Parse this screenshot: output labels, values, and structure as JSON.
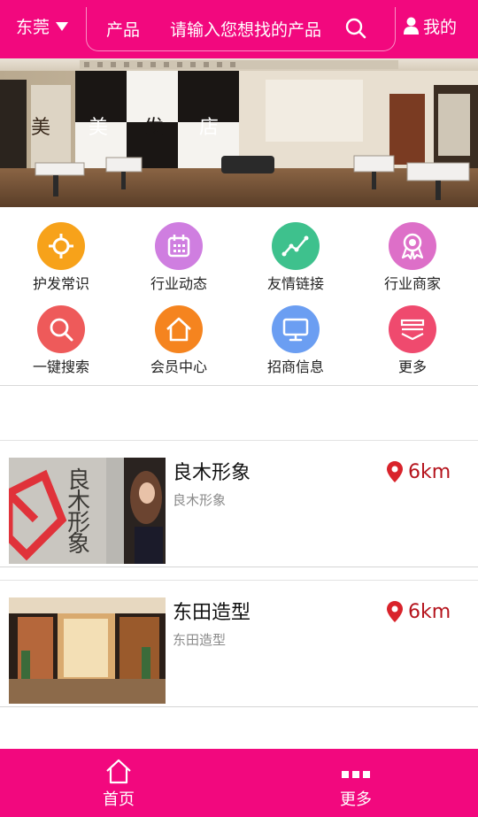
{
  "header": {
    "city": "东莞",
    "search_category": "产品",
    "search_placeholder": "请输入您想找的产品",
    "search_icon": "search-icon",
    "account_label": "我的",
    "account_icon": "user-icon",
    "bg_color": "#f2087e"
  },
  "banner": {
    "sign_chars": [
      "美",
      "美",
      "发",
      "店"
    ]
  },
  "quick_menu": [
    {
      "label": "护发常识",
      "icon": "crosshair-icon",
      "color": "#f7a21a"
    },
    {
      "label": "行业动态",
      "icon": "calendar-icon",
      "color": "#cf7ee0"
    },
    {
      "label": "友情链接",
      "icon": "trend-chart-icon",
      "color": "#3ec18d"
    },
    {
      "label": "行业商家",
      "icon": "award-ribbon-icon",
      "color": "#dd6fc8"
    },
    {
      "label": "一键搜索",
      "icon": "search-icon",
      "color": "#ee5a5a"
    },
    {
      "label": "会员中心",
      "icon": "home-icon",
      "color": "#f5841f"
    },
    {
      "label": "招商信息",
      "icon": "monitor-icon",
      "color": "#6b9ef2"
    },
    {
      "label": "更多",
      "icon": "layers-icon",
      "color": "#ef4a6e"
    }
  ],
  "shops": [
    {
      "name": "良木形象",
      "subtitle": "良木形象",
      "distance": "6km",
      "image_text": "良木形象"
    },
    {
      "name": "东田造型",
      "subtitle": "东田造型",
      "distance": "6km"
    }
  ],
  "bottom_nav": [
    {
      "label": "首页",
      "icon": "home-outline-icon"
    },
    {
      "label": "更多",
      "icon": "dots-icon"
    }
  ],
  "colors": {
    "brand": "#f2087e",
    "distance": "#b5141d",
    "pin": "#d9232b"
  }
}
